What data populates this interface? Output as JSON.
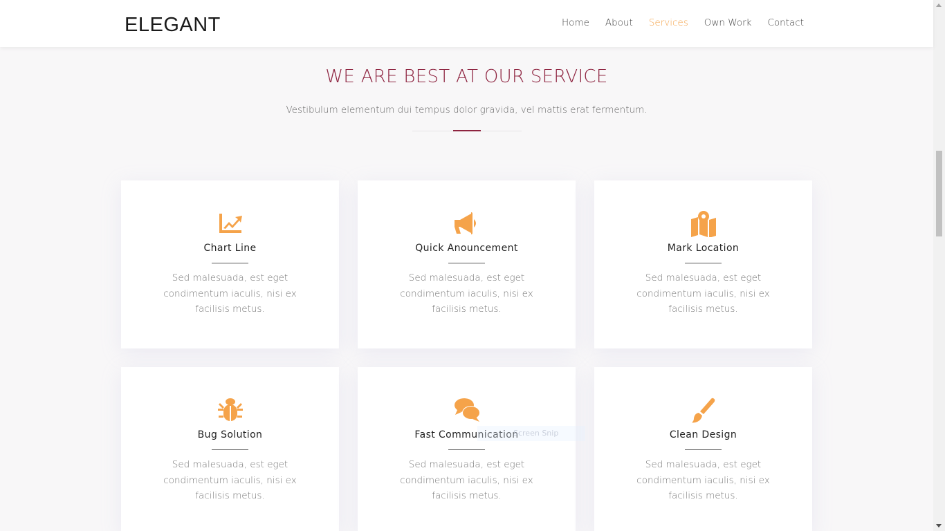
{
  "header": {
    "logo": "ELEGANT",
    "nav": [
      "Home",
      "About",
      "Services",
      "Own Work",
      "Contact"
    ],
    "active_nav": "Services"
  },
  "section": {
    "title": "WE ARE BEST AT OUR SERVICE",
    "subtitle": "Vestibulum elementum dui tempus dolor gravida, vel mattis erat fermentum."
  },
  "cards": [
    {
      "title": "Chart Line",
      "icon": "chart-line-icon",
      "text": "Sed malesuada, est eget condimentum iaculis, nisi ex facilisis metus."
    },
    {
      "title": "Quick Anouncement",
      "icon": "megaphone-icon",
      "text": "Sed malesuada, est eget condimentum iaculis, nisi ex facilisis metus."
    },
    {
      "title": "Mark Location",
      "icon": "map-marker-icon",
      "text": "Sed malesuada, est eget condimentum iaculis, nisi ex facilisis metus."
    },
    {
      "title": "Bug Solution",
      "icon": "bug-icon",
      "text": "Sed malesuada, est eget condimentum iaculis, nisi ex facilisis metus."
    },
    {
      "title": "Fast Communication",
      "icon": "chat-bubbles-icon",
      "text": "Sed malesuada, est eget condimentum iaculis, nisi ex facilisis metus."
    },
    {
      "title": "Clean Design",
      "icon": "paint-brush-icon",
      "text": "Sed malesuada, est eget condimentum iaculis, nisi ex facilisis metus."
    }
  ],
  "overlay": {
    "snip_label": "Screen Snip"
  },
  "colors": {
    "accent": "#f5a34a",
    "title": "#8e2440",
    "active_nav": "#f5a34a"
  }
}
